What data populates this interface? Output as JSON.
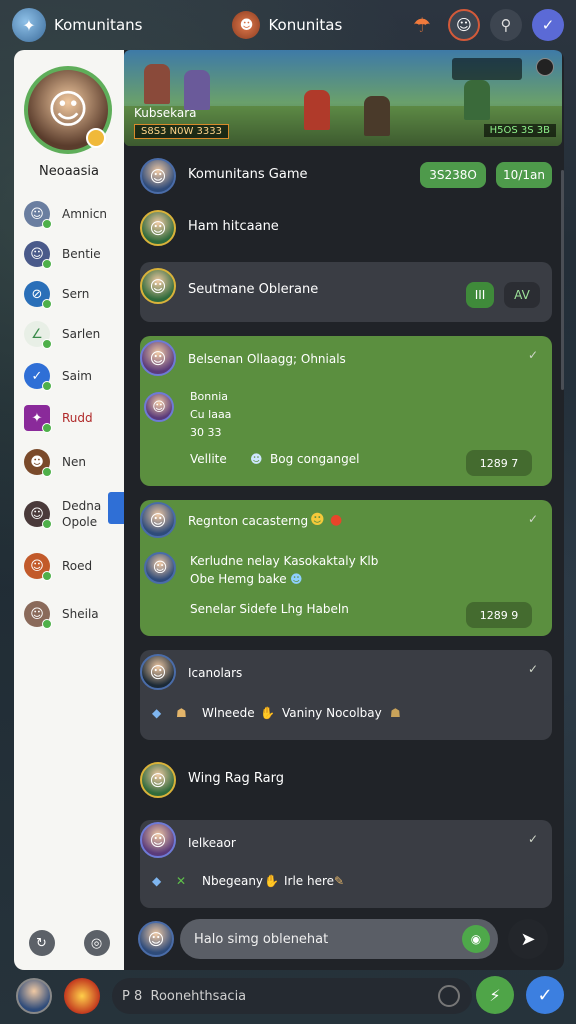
{
  "topbar": {
    "title_left": "Komunitans",
    "title_center": "Konunitas"
  },
  "sidebar": {
    "profile_name": "Neoaasia",
    "items": [
      {
        "label": "Amnicn",
        "icon": "avatar-icon",
        "color": "#6a7ea0"
      },
      {
        "label": "Bentie",
        "icon": "avatar-icon",
        "color": "#4a5a8a"
      },
      {
        "label": "Sern",
        "icon": "compass-icon",
        "color": "#2a6fb8"
      },
      {
        "label": "Sarlen",
        "icon": "link-icon",
        "color": "#3a8a4a"
      },
      {
        "label": "Saim",
        "icon": "check-icon",
        "color": "#2f6fd6"
      },
      {
        "label": "Rudd",
        "icon": "sparkle-icon",
        "color": "#8a2a9a"
      },
      {
        "label": "Nen",
        "icon": "creature-icon",
        "color": "#7a4a2a"
      },
      {
        "label": "Dedna Opole",
        "icon": "avatar-icon",
        "color": "#4a3a3a"
      },
      {
        "label": "Roed",
        "icon": "hat-icon",
        "color": "#c25a2a"
      },
      {
        "label": "Sheila",
        "icon": "avatar-icon",
        "color": "#8a6a5a"
      }
    ]
  },
  "banner": {
    "title": "Kubsekara",
    "subtitle": "S8S3 N0W 3333",
    "stats": "H5OS 3S 3B"
  },
  "header_row": {
    "title": "Komunitans Game",
    "pill1": "3S238O",
    "pill2": "10/1an"
  },
  "row2": {
    "title": "Ham hitcaane"
  },
  "row3": {
    "title": "Seutmane Oblerane",
    "pill1": "III",
    "pill2": "AV"
  },
  "card1": {
    "title": "Belsenan Ollaagg; Ohnials",
    "line1": "Bonnia",
    "line2": "Cu laaa",
    "line3": "30 33",
    "caption": "Vellite",
    "caption2": "Bog congangel",
    "badge": "1289 7"
  },
  "card2": {
    "title": "Regnton cacasterng",
    "line1": "Kerludne nelay Kasokaktaly Klb",
    "line2": "Obe Hemg bake",
    "caption": "Senelar Sidefe Lhg Habeln",
    "badge": "1289 9"
  },
  "card3": {
    "title": "Icanolars",
    "line1": "Wlneede",
    "line2": "Vaniny Nocolbay"
  },
  "row_plain": {
    "title": "Wing Rag Rarg"
  },
  "card4": {
    "title": "Ielkeaor",
    "line1": "Nbegeany",
    "line2": "Irle here"
  },
  "composer": {
    "placeholder": "Halo simg oblenehat"
  },
  "bottombar": {
    "placeholder": "P 8  Roonehthsacia"
  }
}
